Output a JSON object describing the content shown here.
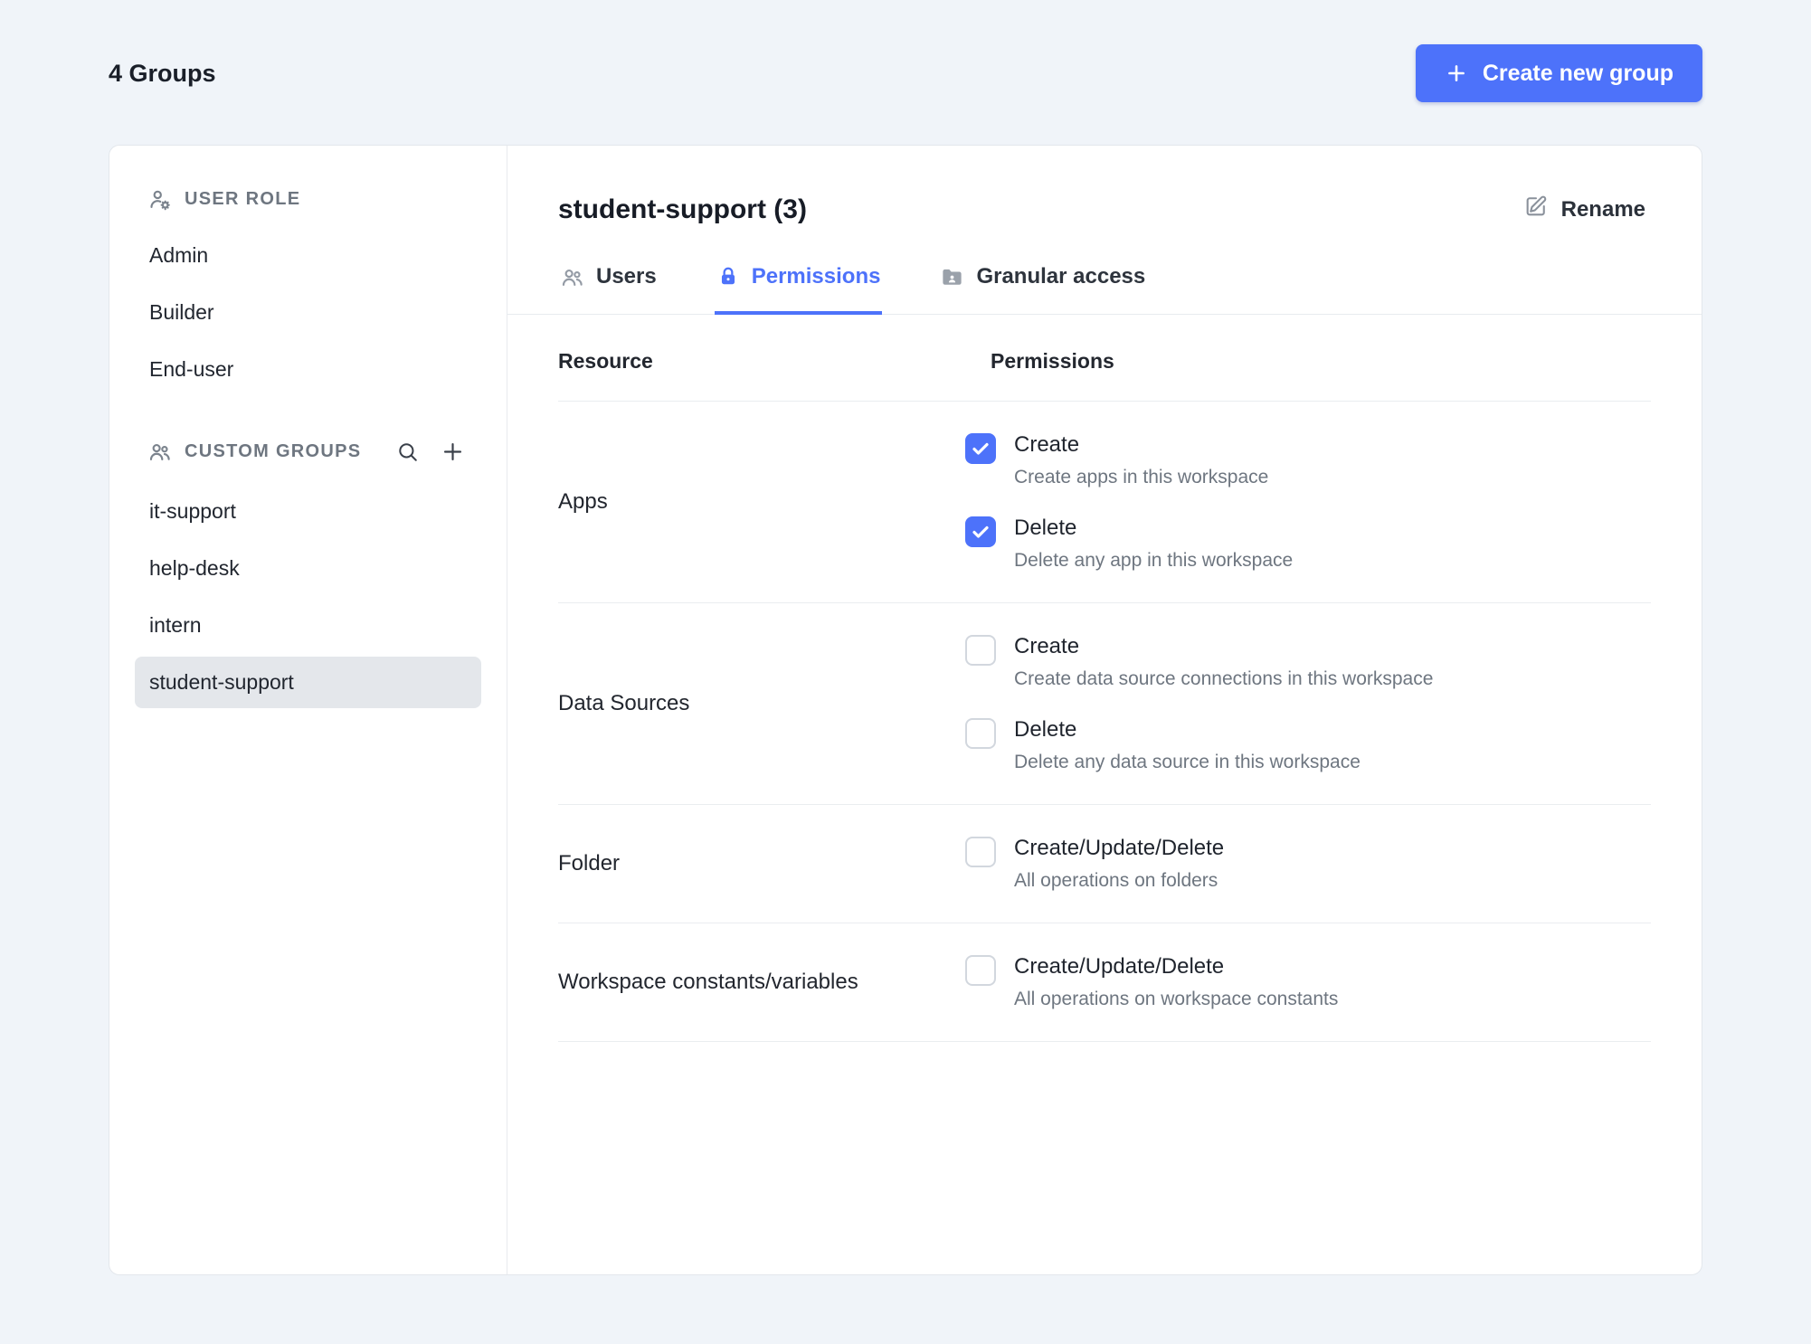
{
  "colors": {
    "accent": "#4d72fa",
    "selected_bg": "#e4e7eb",
    "background": "#f0f4f9"
  },
  "page": {
    "title": "4 Groups",
    "create_button_label": "Create new group"
  },
  "sidebar": {
    "user_role": {
      "header": "USER ROLE",
      "items": [
        "Admin",
        "Builder",
        "End-user"
      ]
    },
    "custom_groups": {
      "header": "CUSTOM GROUPS",
      "items": [
        {
          "label": "it-support",
          "selected": false
        },
        {
          "label": "help-desk",
          "selected": false
        },
        {
          "label": "intern",
          "selected": false
        },
        {
          "label": "student-support",
          "selected": true
        }
      ]
    }
  },
  "content": {
    "title": "student-support (3)",
    "rename_label": "Rename",
    "tabs": [
      {
        "label": "Users",
        "active": false
      },
      {
        "label": "Permissions",
        "active": true
      },
      {
        "label": "Granular access",
        "active": false
      }
    ],
    "table": {
      "headers": {
        "resource": "Resource",
        "permissions": "Permissions"
      },
      "rows": [
        {
          "resource": "Apps",
          "permissions": [
            {
              "label": "Create",
              "description": "Create apps in this workspace",
              "checked": true
            },
            {
              "label": "Delete",
              "description": "Delete any app in this workspace",
              "checked": true
            }
          ]
        },
        {
          "resource": "Data Sources",
          "permissions": [
            {
              "label": "Create",
              "description": "Create data source connections in this workspace",
              "checked": false
            },
            {
              "label": "Delete",
              "description": "Delete any data source in this workspace",
              "checked": false
            }
          ]
        },
        {
          "resource": "Folder",
          "permissions": [
            {
              "label": "Create/Update/Delete",
              "description": "All operations on folders",
              "checked": false
            }
          ]
        },
        {
          "resource": "Workspace constants/variables",
          "permissions": [
            {
              "label": "Create/Update/Delete",
              "description": "All operations on workspace constants",
              "checked": false
            }
          ]
        }
      ]
    }
  }
}
